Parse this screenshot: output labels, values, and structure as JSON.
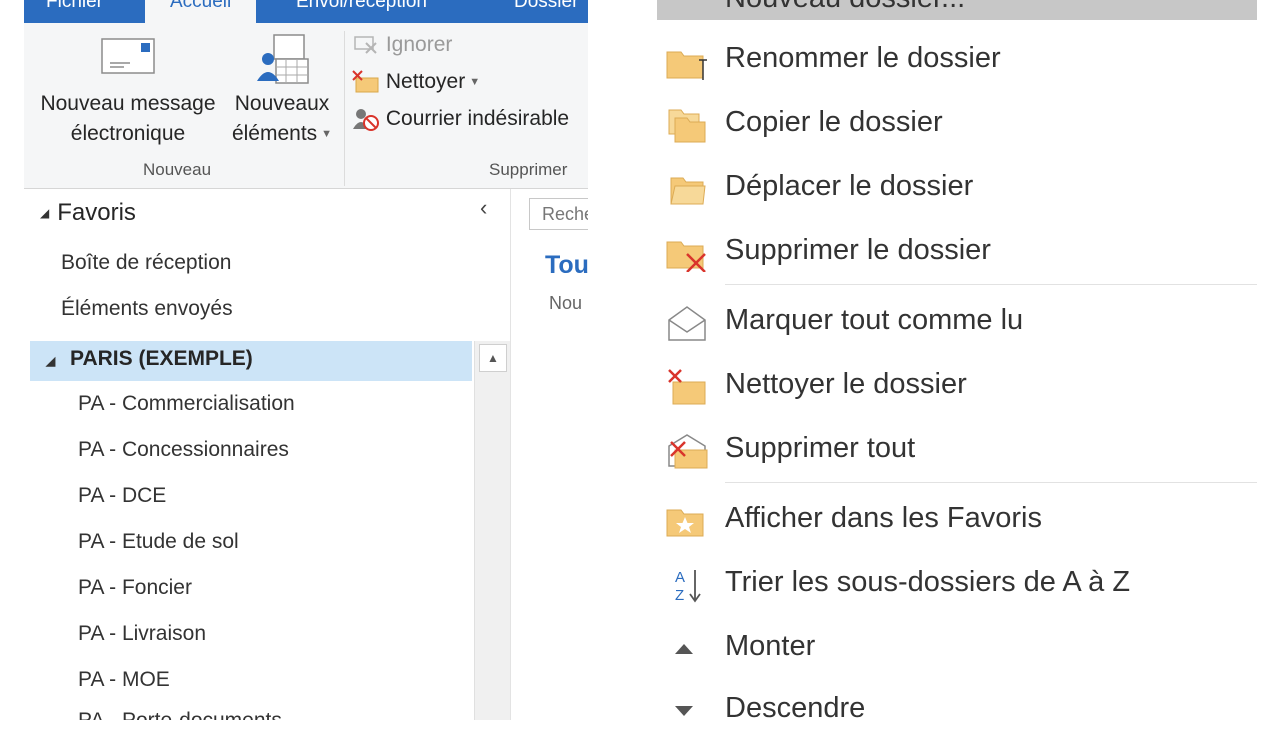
{
  "ribbon": {
    "tabs": [
      "Fichier",
      "Accueil",
      "Envoi/réception",
      "Dossier"
    ],
    "new_email_label": "Nouveau message électronique",
    "new_items_label": "Nouveaux éléments",
    "ignore_label": "Ignorer",
    "clean_label": "Nettoyer",
    "junk_label": "Courrier indésirable",
    "group_new": "Nouveau",
    "group_delete": "Supprimer"
  },
  "folder_pane": {
    "favorites_title": "Favoris",
    "favorites": [
      "Boîte de réception",
      "Éléments envoyés"
    ],
    "account": "PARIS (EXEMPLE)",
    "folders": [
      "PA - Commercialisation",
      "PA - Concessionnaires",
      "PA - DCE",
      "PA - Etude de sol",
      "PA - Foncier",
      "PA - Livraison",
      "PA - MOE",
      "PA - Porte-documents"
    ]
  },
  "mail_pane": {
    "search_placeholder": "Reche",
    "tab_all": "Tou",
    "new_text": "Nou"
  },
  "context_menu": {
    "top_item": "Nouveau dossier...",
    "items": [
      {
        "label": "Renommer le dossier",
        "icon": "folder-rename-icon"
      },
      {
        "label": "Copier le dossier",
        "icon": "folder-copy-icon"
      },
      {
        "label": "Déplacer le dossier",
        "icon": "folder-move-icon"
      },
      {
        "label": "Supprimer le dossier",
        "icon": "folder-delete-icon"
      },
      {
        "label": "Marquer tout comme lu",
        "icon": "envelope-open-icon"
      },
      {
        "label": "Nettoyer le dossier",
        "icon": "clean-folder-icon"
      },
      {
        "label": "Supprimer tout",
        "icon": "delete-all-icon"
      },
      {
        "label": "Afficher dans les Favoris",
        "icon": "star-folder-icon"
      },
      {
        "label": "Trier les sous-dossiers de A à Z",
        "icon": "sort-az-icon"
      },
      {
        "label": "Monter",
        "icon": "triangle-up-icon"
      },
      {
        "label": "Descendre",
        "icon": "triangle-down-icon"
      }
    ]
  },
  "colors": {
    "accent": "#2b6cbf",
    "selection": "#cce4f7",
    "folder": "#f5c978"
  }
}
